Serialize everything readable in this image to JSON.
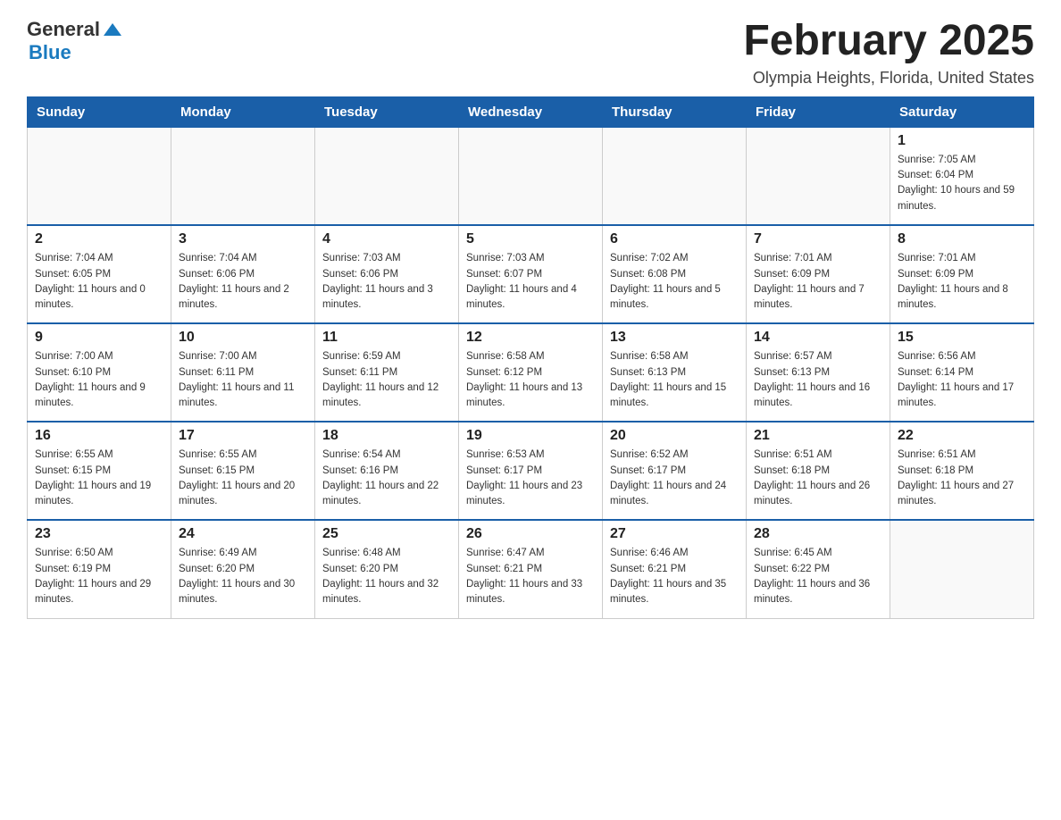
{
  "logo": {
    "text_general": "General",
    "text_blue": "Blue"
  },
  "calendar": {
    "title": "February 2025",
    "subtitle": "Olympia Heights, Florida, United States",
    "headers": [
      "Sunday",
      "Monday",
      "Tuesday",
      "Wednesday",
      "Thursday",
      "Friday",
      "Saturday"
    ],
    "weeks": [
      [
        {
          "day": "",
          "info": ""
        },
        {
          "day": "",
          "info": ""
        },
        {
          "day": "",
          "info": ""
        },
        {
          "day": "",
          "info": ""
        },
        {
          "day": "",
          "info": ""
        },
        {
          "day": "",
          "info": ""
        },
        {
          "day": "1",
          "info": "Sunrise: 7:05 AM\nSunset: 6:04 PM\nDaylight: 10 hours and 59 minutes."
        }
      ],
      [
        {
          "day": "2",
          "info": "Sunrise: 7:04 AM\nSunset: 6:05 PM\nDaylight: 11 hours and 0 minutes."
        },
        {
          "day": "3",
          "info": "Sunrise: 7:04 AM\nSunset: 6:06 PM\nDaylight: 11 hours and 2 minutes."
        },
        {
          "day": "4",
          "info": "Sunrise: 7:03 AM\nSunset: 6:06 PM\nDaylight: 11 hours and 3 minutes."
        },
        {
          "day": "5",
          "info": "Sunrise: 7:03 AM\nSunset: 6:07 PM\nDaylight: 11 hours and 4 minutes."
        },
        {
          "day": "6",
          "info": "Sunrise: 7:02 AM\nSunset: 6:08 PM\nDaylight: 11 hours and 5 minutes."
        },
        {
          "day": "7",
          "info": "Sunrise: 7:01 AM\nSunset: 6:09 PM\nDaylight: 11 hours and 7 minutes."
        },
        {
          "day": "8",
          "info": "Sunrise: 7:01 AM\nSunset: 6:09 PM\nDaylight: 11 hours and 8 minutes."
        }
      ],
      [
        {
          "day": "9",
          "info": "Sunrise: 7:00 AM\nSunset: 6:10 PM\nDaylight: 11 hours and 9 minutes."
        },
        {
          "day": "10",
          "info": "Sunrise: 7:00 AM\nSunset: 6:11 PM\nDaylight: 11 hours and 11 minutes."
        },
        {
          "day": "11",
          "info": "Sunrise: 6:59 AM\nSunset: 6:11 PM\nDaylight: 11 hours and 12 minutes."
        },
        {
          "day": "12",
          "info": "Sunrise: 6:58 AM\nSunset: 6:12 PM\nDaylight: 11 hours and 13 minutes."
        },
        {
          "day": "13",
          "info": "Sunrise: 6:58 AM\nSunset: 6:13 PM\nDaylight: 11 hours and 15 minutes."
        },
        {
          "day": "14",
          "info": "Sunrise: 6:57 AM\nSunset: 6:13 PM\nDaylight: 11 hours and 16 minutes."
        },
        {
          "day": "15",
          "info": "Sunrise: 6:56 AM\nSunset: 6:14 PM\nDaylight: 11 hours and 17 minutes."
        }
      ],
      [
        {
          "day": "16",
          "info": "Sunrise: 6:55 AM\nSunset: 6:15 PM\nDaylight: 11 hours and 19 minutes."
        },
        {
          "day": "17",
          "info": "Sunrise: 6:55 AM\nSunset: 6:15 PM\nDaylight: 11 hours and 20 minutes."
        },
        {
          "day": "18",
          "info": "Sunrise: 6:54 AM\nSunset: 6:16 PM\nDaylight: 11 hours and 22 minutes."
        },
        {
          "day": "19",
          "info": "Sunrise: 6:53 AM\nSunset: 6:17 PM\nDaylight: 11 hours and 23 minutes."
        },
        {
          "day": "20",
          "info": "Sunrise: 6:52 AM\nSunset: 6:17 PM\nDaylight: 11 hours and 24 minutes."
        },
        {
          "day": "21",
          "info": "Sunrise: 6:51 AM\nSunset: 6:18 PM\nDaylight: 11 hours and 26 minutes."
        },
        {
          "day": "22",
          "info": "Sunrise: 6:51 AM\nSunset: 6:18 PM\nDaylight: 11 hours and 27 minutes."
        }
      ],
      [
        {
          "day": "23",
          "info": "Sunrise: 6:50 AM\nSunset: 6:19 PM\nDaylight: 11 hours and 29 minutes."
        },
        {
          "day": "24",
          "info": "Sunrise: 6:49 AM\nSunset: 6:20 PM\nDaylight: 11 hours and 30 minutes."
        },
        {
          "day": "25",
          "info": "Sunrise: 6:48 AM\nSunset: 6:20 PM\nDaylight: 11 hours and 32 minutes."
        },
        {
          "day": "26",
          "info": "Sunrise: 6:47 AM\nSunset: 6:21 PM\nDaylight: 11 hours and 33 minutes."
        },
        {
          "day": "27",
          "info": "Sunrise: 6:46 AM\nSunset: 6:21 PM\nDaylight: 11 hours and 35 minutes."
        },
        {
          "day": "28",
          "info": "Sunrise: 6:45 AM\nSunset: 6:22 PM\nDaylight: 11 hours and 36 minutes."
        },
        {
          "day": "",
          "info": ""
        }
      ]
    ]
  }
}
